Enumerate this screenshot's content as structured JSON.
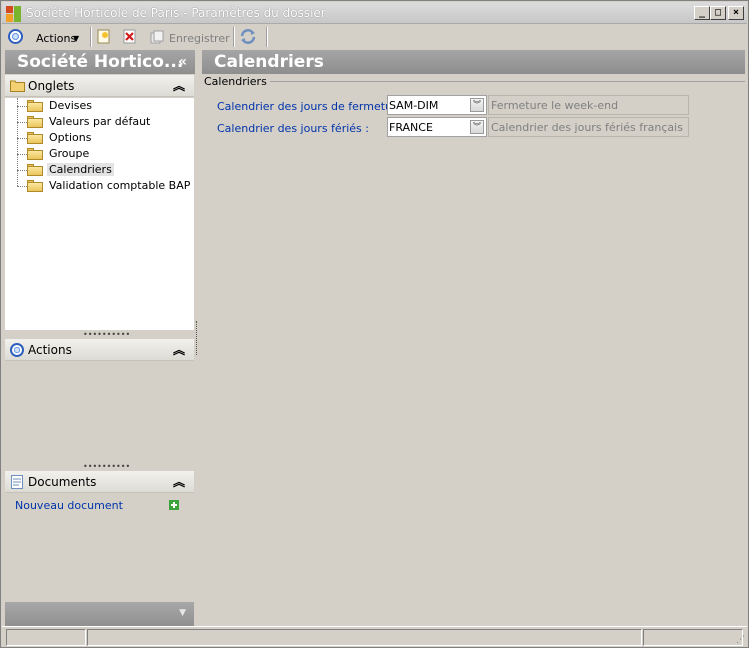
{
  "window": {
    "title": "Société Horticole de Paris  -  Paramètres du dossier",
    "minimize": "_",
    "maximize": "□",
    "close": "×"
  },
  "toolbar": {
    "actions_label": "Actions",
    "save_label": "Enregistrer"
  },
  "left_panel": {
    "header": "Société Hortico...",
    "collapse_glyph": "«",
    "tabs_section": {
      "label": "Onglets",
      "items": [
        {
          "label": "Devises"
        },
        {
          "label": "Valeurs par défaut"
        },
        {
          "label": "Options"
        },
        {
          "label": "Groupe"
        },
        {
          "label": "Calendriers"
        },
        {
          "label": "Validation comptable BAP"
        }
      ]
    },
    "actions_section": {
      "label": "Actions"
    },
    "documents_section": {
      "label": "Documents",
      "new_document": "Nouveau document"
    }
  },
  "content": {
    "header": "Calendriers",
    "group_title": "Calendriers",
    "fields": [
      {
        "label": "Calendrier des jours de fermeture :",
        "value": "SAM-DIM",
        "description": "Fermeture le week-end"
      },
      {
        "label": "Calendrier des jours fériés :",
        "value": "FRANCE",
        "description": "Calendrier des jours fériés français"
      }
    ]
  },
  "colors": {
    "header_gray": "#9a9a9a",
    "link_blue": "#0033aa",
    "window_bg": "#d4d0c8"
  }
}
